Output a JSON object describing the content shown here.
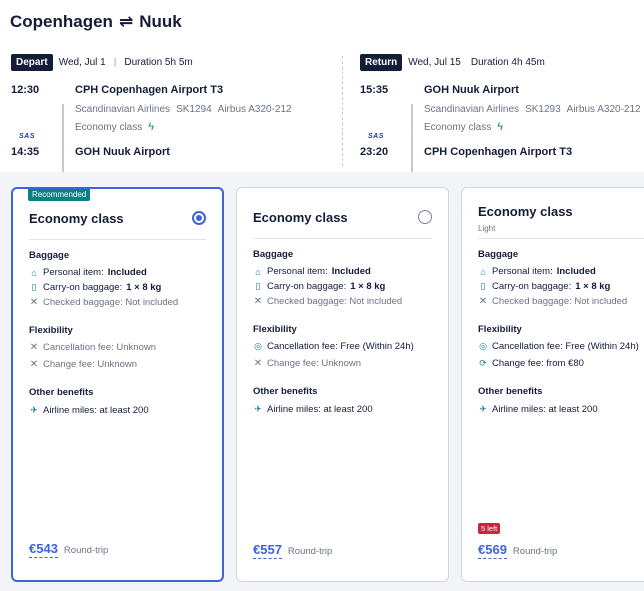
{
  "route": {
    "from": "Copenhagen",
    "swap": "⇌",
    "to": "Nuuk"
  },
  "depart": {
    "badge": "Depart",
    "date": "Wed, Jul 1",
    "divider": "|",
    "duration": "Duration 5h 5m",
    "dep_time": "12:30",
    "dep_airport": "CPH Copenhagen Airport T3",
    "airline": "Scandinavian Airlines",
    "flight": "SK1294",
    "aircraft": "Airbus A320-212",
    "cabin": "Economy class",
    "logo": "SAS",
    "arr_time": "14:35",
    "arr_airport": "GOH Nuuk Airport"
  },
  "return": {
    "badge": "Return",
    "date": "Wed, Jul 15",
    "duration": "Duration 4h 45m",
    "dep_time": "15:35",
    "dep_airport": "GOH Nuuk Airport",
    "airline": "Scandinavian Airlines",
    "flight": "SK1293",
    "aircraft": "Airbus A320-212",
    "cabin": "Economy class",
    "logo": "SAS",
    "arr_time": "23:20",
    "arr_airport": "CPH Copenhagen Airport T3"
  },
  "cards": [
    {
      "recommended": "Recommended",
      "title": "Economy class",
      "selected": true,
      "baggage_h": "Baggage",
      "personal_k": "Personal item: ",
      "personal_v": "Included",
      "carry_k": "Carry-on baggage: ",
      "carry_v": "1 × 8 kg",
      "checked": "Checked baggage: Not included",
      "flex_h": "Flexibility",
      "cancel": "Cancellation fee: Unknown",
      "change": "Change fee: Unknown",
      "other_h": "Other benefits",
      "miles": "Airline miles: at least 200",
      "price": "€543",
      "price_note": "Round-trip"
    },
    {
      "title": "Economy class",
      "selected": false,
      "baggage_h": "Baggage",
      "personal_k": "Personal item: ",
      "personal_v": "Included",
      "carry_k": "Carry-on baggage: ",
      "carry_v": "1 × 8 kg",
      "checked": "Checked baggage: Not included",
      "flex_h": "Flexibility",
      "cancel": "Cancellation fee: Free (Within 24h)",
      "change": "Change fee: Unknown",
      "other_h": "Other benefits",
      "miles": "Airline miles: at least 200",
      "price": "€557",
      "price_note": "Round-trip"
    },
    {
      "title": "Economy class",
      "subtitle": "Light",
      "selected": false,
      "baggage_h": "Baggage",
      "personal_k": "Personal item: ",
      "personal_v": "Included",
      "carry_k": "Carry-on baggage: ",
      "carry_v": "1 × 8 kg",
      "checked": "Checked baggage: Not included",
      "flex_h": "Flexibility",
      "cancel": "Cancellation fee: Free (Within 24h)",
      "change": "Change fee: from €80",
      "other_h": "Other benefits",
      "miles": "Airline miles: at least 200",
      "seats_left": "5 left",
      "price": "€569",
      "price_note": "Round-trip"
    }
  ],
  "colors": {
    "accent": "#3d63dd",
    "teal": "#0c7f85",
    "alert": "#c5283d",
    "navy": "#141d38"
  }
}
